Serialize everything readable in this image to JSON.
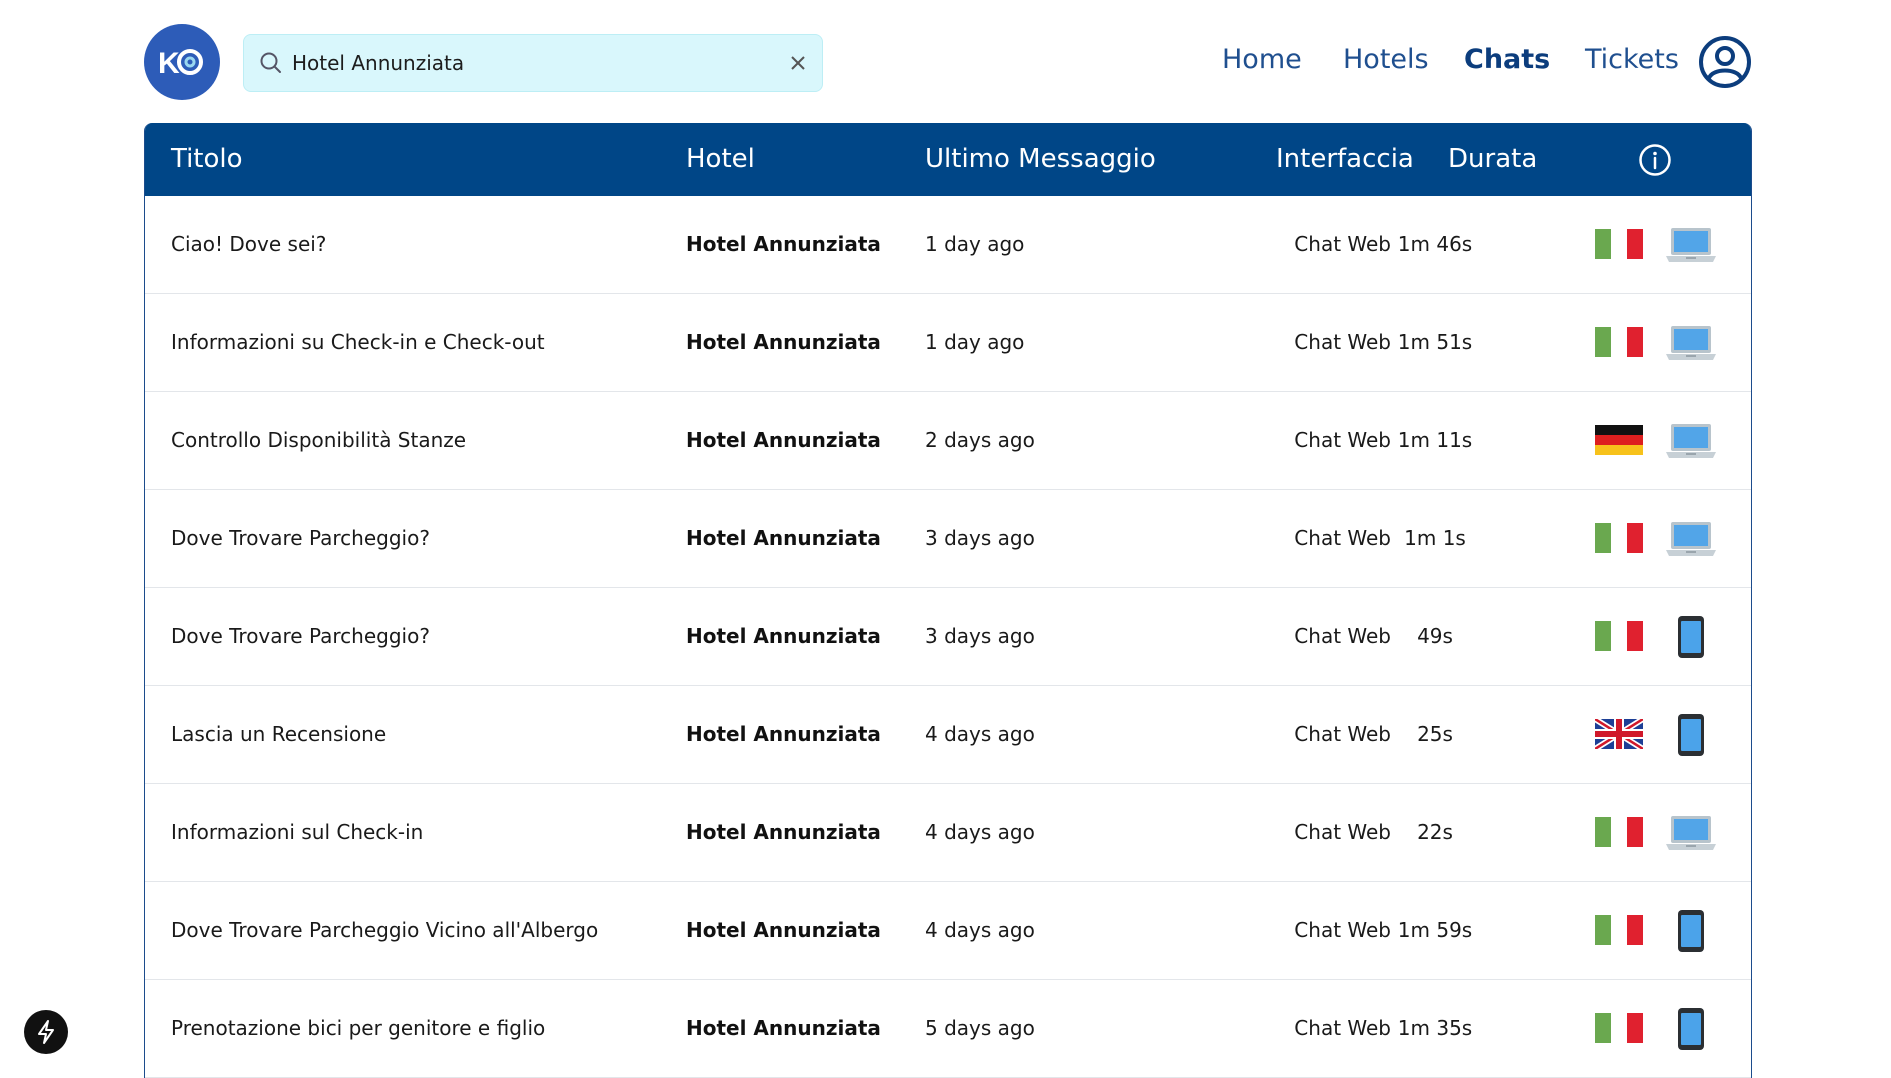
{
  "search": {
    "value": "Hotel Annunziata",
    "placeholder": ""
  },
  "nav": [
    {
      "label": "Home",
      "active": false
    },
    {
      "label": "Hotels",
      "active": false
    },
    {
      "label": "Chats",
      "active": true
    },
    {
      "label": "Tickets",
      "active": false
    }
  ],
  "table": {
    "headers": {
      "title": "Titolo",
      "hotel": "Hotel",
      "last_message": "Ultimo Messaggio",
      "interface": "Interfaccia",
      "duration": "Durata"
    },
    "rows": [
      {
        "title": "Ciao! Dove sei?",
        "hotel": "Hotel Annunziata",
        "last_message": "1 day ago",
        "interface": "Chat Web",
        "duration": "1m 46s",
        "flag": "italy-flag-icon",
        "device": "laptop-icon"
      },
      {
        "title": "Informazioni su Check-in e Check-out",
        "hotel": "Hotel Annunziata",
        "last_message": "1 day ago",
        "interface": "Chat Web",
        "duration": "1m 51s",
        "flag": "italy-flag-icon",
        "device": "laptop-icon"
      },
      {
        "title": "Controllo Disponibilità Stanze",
        "hotel": "Hotel Annunziata",
        "last_message": "2 days ago",
        "interface": "Chat Web",
        "duration": "1m 11s",
        "flag": "germany-flag-icon",
        "device": "laptop-icon"
      },
      {
        "title": "Dove Trovare Parcheggio?",
        "hotel": "Hotel Annunziata",
        "last_message": "3 days ago",
        "interface": "Chat Web",
        "duration": "1m 1s",
        "flag": "italy-flag-icon",
        "device": "laptop-icon"
      },
      {
        "title": "Dove Trovare Parcheggio?",
        "hotel": "Hotel Annunziata",
        "last_message": "3 days ago",
        "interface": "Chat Web",
        "duration": "49s",
        "flag": "italy-flag-icon",
        "device": "phone-icon"
      },
      {
        "title": "Lascia un Recensione",
        "hotel": "Hotel Annunziata",
        "last_message": "4 days ago",
        "interface": "Chat Web",
        "duration": "25s",
        "flag": "uk-flag-icon",
        "device": "phone-icon"
      },
      {
        "title": "Informazioni sul Check-in",
        "hotel": "Hotel Annunziata",
        "last_message": "4 days ago",
        "interface": "Chat Web",
        "duration": "22s",
        "flag": "italy-flag-icon",
        "device": "laptop-icon"
      },
      {
        "title": "Dove Trovare Parcheggio Vicino all'Albergo",
        "hotel": "Hotel Annunziata",
        "last_message": "4 days ago",
        "interface": "Chat Web",
        "duration": "1m 59s",
        "flag": "italy-flag-icon",
        "device": "phone-icon"
      },
      {
        "title": "Prenotazione bici per genitore e figlio",
        "hotel": "Hotel Annunziata",
        "last_message": "5 days ago",
        "interface": "Chat Web",
        "duration": "1m 35s",
        "flag": "italy-flag-icon",
        "device": "phone-icon"
      }
    ]
  },
  "colors": {
    "header_bg": "#004687",
    "search_bg": "#d9f7fc",
    "nav_text": "#1f4f8f",
    "logo_bg": "#2d5cb8"
  },
  "icons": {
    "logo": "ko-logo-icon",
    "search": "search-icon",
    "clear": "close-icon",
    "user": "user-circle-icon",
    "info": "info-icon",
    "bolt": "bolt-icon"
  }
}
